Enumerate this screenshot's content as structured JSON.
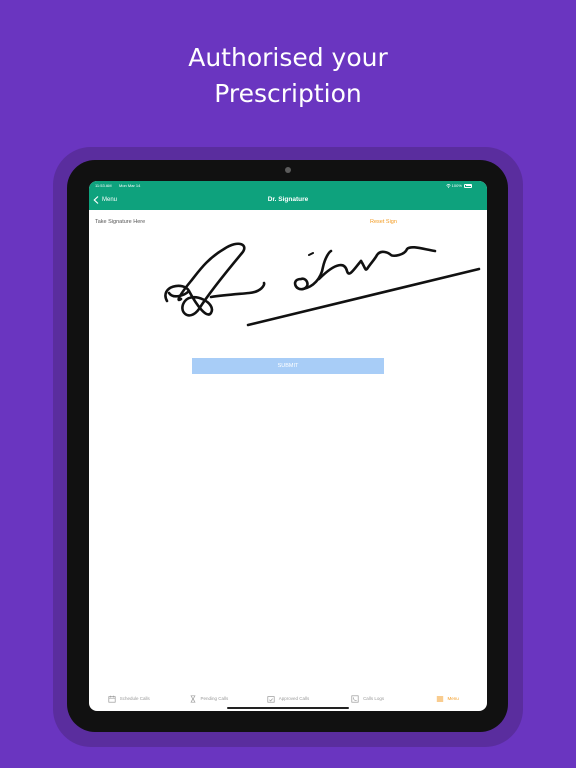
{
  "headline": {
    "line1": "Authorised your",
    "line2": "Prescription"
  },
  "status_bar": {
    "time": "11:53 AM",
    "date": "Mon Mar 14",
    "battery": "100%"
  },
  "nav": {
    "back_label": "Menu",
    "title": "Dr. Signature"
  },
  "signature": {
    "label": "Take Signature Here",
    "reset_label": "Reset Sign"
  },
  "submit_label": "SUBMIT",
  "tabs": [
    {
      "label": "Schedule Calls",
      "icon": "calendar-icon"
    },
    {
      "label": "Pending Calls",
      "icon": "hourglass-icon"
    },
    {
      "label": "Approved Calls",
      "icon": "approved-calendar-icon"
    },
    {
      "label": "Calls Logs",
      "icon": "phone-log-icon"
    },
    {
      "label": "Menu",
      "icon": "menu-icon",
      "active": true
    }
  ],
  "colors": {
    "background": "#6a35c0",
    "nav": "#0ea27d",
    "accent": "#f39a1f",
    "submit": "#a8cdf7"
  }
}
